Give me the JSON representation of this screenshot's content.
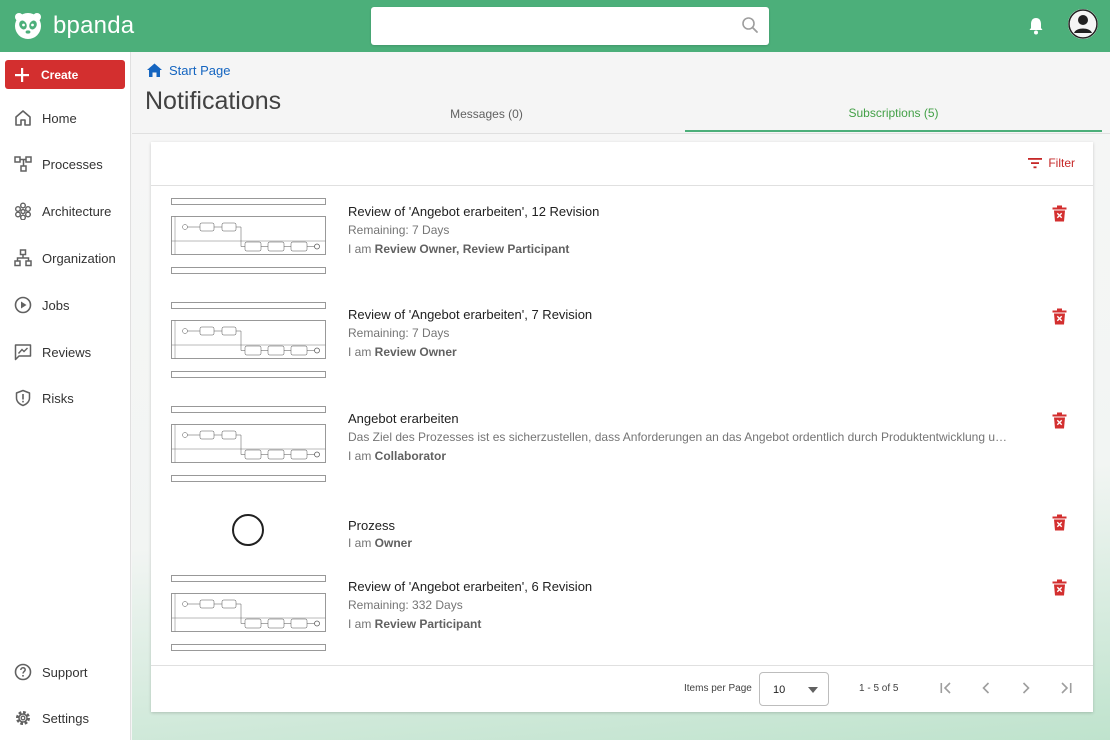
{
  "app": {
    "name": "bpanda"
  },
  "search": {
    "placeholder": ""
  },
  "sidebar": {
    "create_label": "Create",
    "items": [
      {
        "label": "Home",
        "icon": "home-icon"
      },
      {
        "label": "Processes",
        "icon": "processes-icon"
      },
      {
        "label": "Architecture",
        "icon": "architecture-icon"
      },
      {
        "label": "Organization",
        "icon": "organization-icon"
      },
      {
        "label": "Jobs",
        "icon": "jobs-icon"
      },
      {
        "label": "Reviews",
        "icon": "reviews-icon"
      },
      {
        "label": "Risks",
        "icon": "risks-icon"
      }
    ],
    "bottom": [
      {
        "label": "Support",
        "icon": "support-icon"
      },
      {
        "label": "Settings",
        "icon": "settings-icon"
      }
    ]
  },
  "breadcrumb": {
    "label": "Start Page"
  },
  "page": {
    "title": "Notifications"
  },
  "tabs": [
    {
      "label": "Messages (0)",
      "active": false
    },
    {
      "label": "Subscriptions (5)",
      "active": true
    }
  ],
  "filter_label": "Filter",
  "notifications": [
    {
      "title": "Review of 'Angebot erarbeiten', 12 Revision",
      "subtitle": "Remaining: 7 Days",
      "role_prefix": "I am ",
      "roles": "Review Owner, Review Participant",
      "thumb": "diagram"
    },
    {
      "title": "Review of 'Angebot erarbeiten', 7 Revision",
      "subtitle": "Remaining: 7 Days",
      "role_prefix": "I am ",
      "roles": "Review Owner",
      "thumb": "diagram"
    },
    {
      "title": "Angebot erarbeiten",
      "subtitle": "Das Ziel des Prozesses ist es sicherzustellen, dass Anforderungen an das Angebot ordentlich durch Produktentwicklung u…",
      "role_prefix": "I am ",
      "roles": "Collaborator",
      "thumb": "diagram"
    },
    {
      "title": "Prozess",
      "subtitle": "",
      "role_prefix": "I am ",
      "roles": "Owner",
      "thumb": "circle"
    },
    {
      "title": "Review of 'Angebot erarbeiten', 6 Revision",
      "subtitle": "Remaining: 332 Days",
      "role_prefix": "I am ",
      "roles": "Review Participant",
      "thumb": "diagram"
    }
  ],
  "pagination": {
    "items_per_page_label": "Items per Page",
    "items_per_page_value": "10",
    "range_label": "1 - 5 of 5"
  },
  "colors": {
    "brand": "#4caf7a",
    "create": "#d32f2f",
    "accent_tab": "#43a047",
    "danger": "#c62828",
    "link": "#1565c0"
  }
}
